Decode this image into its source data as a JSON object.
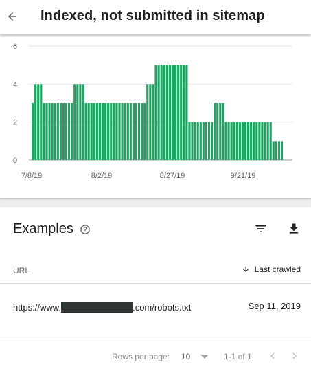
{
  "header": {
    "title": "Indexed, not submitted in sitemap",
    "back_icon": "arrow-back-icon"
  },
  "colors": {
    "bar": "#1da462",
    "grid": "#e6e6e6",
    "axis": "#5f6368"
  },
  "chart_data": {
    "type": "bar",
    "x_ticks": [
      "7/8/19",
      "8/2/19",
      "8/27/19",
      "9/21/19"
    ],
    "ylim": [
      0,
      6
    ],
    "y_ticks": [
      "0",
      "2",
      "4",
      "6"
    ],
    "grid": true,
    "series": [
      {
        "values": [
          3,
          4,
          4,
          4,
          3,
          3,
          3,
          3,
          3,
          3,
          3,
          3,
          3,
          3,
          3,
          4,
          4,
          4,
          4,
          3,
          3,
          3,
          3,
          3,
          3,
          3,
          3,
          3,
          3,
          3,
          3,
          3,
          3,
          3,
          3,
          3,
          3,
          3,
          3,
          3,
          3,
          4,
          4,
          4,
          5,
          5,
          5,
          5,
          5,
          5,
          5,
          5,
          5,
          5,
          5,
          5,
          2,
          2,
          2,
          2,
          2,
          2,
          2,
          2,
          2,
          3,
          3,
          3,
          3,
          2,
          2,
          2,
          2,
          2,
          2,
          2,
          2,
          2,
          2,
          2,
          2,
          2,
          2,
          2,
          2,
          2,
          1,
          1,
          1,
          1
        ]
      }
    ]
  },
  "examples": {
    "title": "Examples",
    "help_icon": "help-circle-icon",
    "filter_icon": "filter-icon",
    "download_icon": "download-icon",
    "columns": {
      "url": "URL",
      "last_crawled": "Last crawled"
    },
    "rows": [
      {
        "url_prefix": "https://www.",
        "url_suffix": ".com/robots.txt",
        "last_crawled": "Sep 11, 2019"
      }
    ]
  },
  "pagination": {
    "rows_per_page_label": "Rows per page:",
    "rows_per_page_value": "10",
    "range": "1-1 of 1"
  }
}
